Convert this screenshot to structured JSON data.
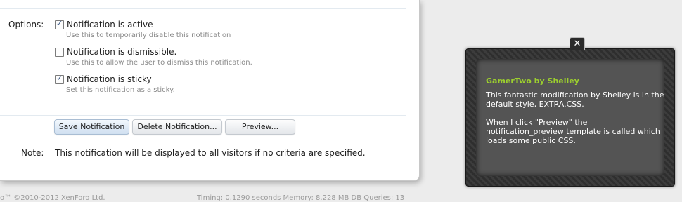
{
  "options": {
    "label": "Options:",
    "items": [
      {
        "label": "Notification is active",
        "hint": "Use this to temporarily disable this notification",
        "checked": true
      },
      {
        "label": "Notification is dismissible.",
        "hint": "Use this to allow the user to dismiss this notification.",
        "checked": false
      },
      {
        "label": "Notification is sticky",
        "hint": "Set this notification as a sticky.",
        "checked": true
      }
    ]
  },
  "buttons": {
    "save": "Save Notification",
    "delete": "Delete Notification...",
    "preview": "Preview..."
  },
  "note": {
    "label": "Note:",
    "text": "This notification will be displayed to all visitors if no criteria are specified."
  },
  "footer": {
    "copyright": "o™ ©2010-2012 XenForo Ltd.",
    "timing": "Timing: 0.1290 seconds Memory: 8.228 MB DB Queries: 13"
  },
  "notice": {
    "close_glyph": "✕",
    "title": "GamerTwo by Shelley",
    "paragraph1": "This fantastic modification by Shelley is in the default style, EXTRA.CSS.",
    "paragraph2": "When I click \"Preview\" the notification_preview template is called which loads some public CSS."
  },
  "colors": {
    "notice_title": "#9ccf2e",
    "notice_background": "#545454",
    "page_background": "#ececec"
  }
}
